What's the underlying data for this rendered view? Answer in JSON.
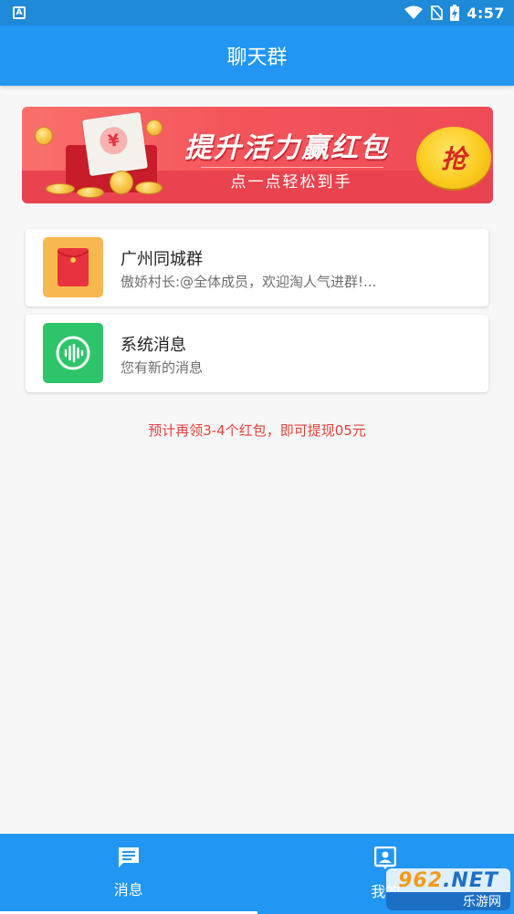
{
  "status_bar": {
    "notification_icon_letter": "A",
    "time": "4:57",
    "battery_glyph": "⚡"
  },
  "app_bar": {
    "title": "聊天群"
  },
  "banner": {
    "title": "提升活力赢红包",
    "subtitle": "点一点轻松到手",
    "button_label": "抢",
    "envelope_symbol": "¥"
  },
  "chats": [
    {
      "name": "广州同城群",
      "preview": "傲娇村长:@全体成员，欢迎淘人气进群!...",
      "icon": "red-envelope-icon",
      "avatar_color": "#f9b84f"
    },
    {
      "name": "系统消息",
      "preview": "您有新的消息",
      "icon": "voice-wave-icon",
      "avatar_color": "#2ec56a"
    }
  ],
  "tip": "预计再领3-4个红包，即可提现05元",
  "bottom_nav": {
    "items": [
      {
        "label": "消息",
        "icon": "chat-icon",
        "active": true
      },
      {
        "label": "我的",
        "icon": "profile-icon",
        "active": false
      }
    ]
  },
  "watermark": {
    "top_number": "962",
    "top_suffix": ".NET",
    "bottom_text": "乐游网"
  },
  "colors": {
    "primary": "#2196f3",
    "status_bar": "#1e8ad8",
    "tip_text": "#e5413c"
  }
}
